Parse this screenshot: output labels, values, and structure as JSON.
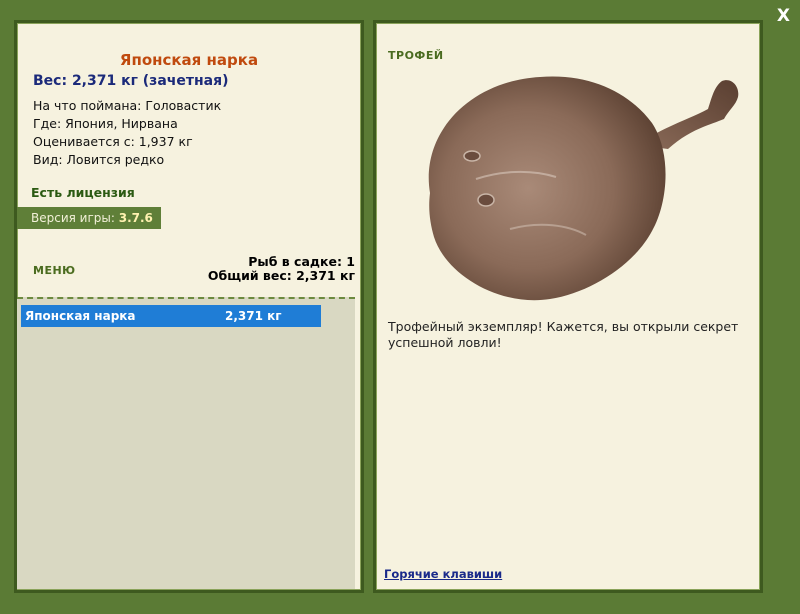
{
  "window": {
    "close_label": "X"
  },
  "fish": {
    "name": "Японская нарка",
    "weight_line": "Вес: 2,371 кг (зачетная)",
    "caught_on": "На что поймана: Головастик",
    "location": "Где: Япония, Нирвана",
    "counted_from": "Оценивается с: 1,937 кг",
    "rarity": "Вид: Ловится редко"
  },
  "license": "Есть лицензия",
  "version": {
    "label": "Версия игры:",
    "value": "3.7.6"
  },
  "menu_label": "МЕНЮ",
  "keepnet": {
    "count_line": "Рыб в садке: 1",
    "total_line": "Общий вес: 2,371 кг"
  },
  "catch_list": [
    {
      "name": "Японская нарка",
      "weight": "2,371 кг"
    }
  ],
  "trophy": {
    "label": "ТРОФЕЙ",
    "text": "Трофейный экземпляр! Кажется, вы открыли секрет успешной ловли!"
  },
  "hotkeys_label": "Горячие клавиши",
  "colors": {
    "frame": "#5b7b35",
    "panel": "#f6f2df",
    "title": "#c04a0e",
    "weight": "#1b2a7a",
    "selected_row": "#1f7dd6"
  }
}
